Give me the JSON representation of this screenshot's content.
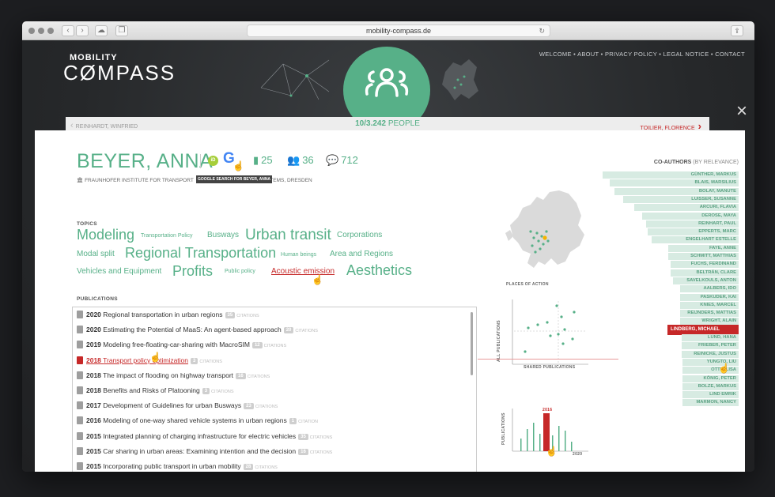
{
  "browser": {
    "url": "mobility-compass.de"
  },
  "site": {
    "logo_top": "MOBILITY",
    "logo_bottom": "CØMPASS",
    "nav": [
      "WELCOME",
      "ABOUT",
      "PRIVACY POLICY",
      "LEGAL NOTICE",
      "CONTACT"
    ]
  },
  "people_bar": {
    "prev_name": "REINHARDT, WINFRIED",
    "current": "10",
    "total": "/3.242",
    "label": " PEOPLE",
    "next_name": "TOILIER, FLORENCE"
  },
  "person": {
    "name": "BEYER, ANNA",
    "orcid_label": "iD",
    "google_tooltip": "GOOGLE SEARCH FOR BEYER, ANNA",
    "institute_pre": "FRAUNHOFER INSTITUTE FOR TRANSPORT",
    "institute_post": "SYSTEMS, DRESDEN",
    "publications_count": "25",
    "coauthors_count": "36",
    "citations_count": "712"
  },
  "topics": {
    "heading": "TOPICS",
    "items": [
      "Modeling",
      "Transportation Policy",
      "Busways",
      "Urban transit",
      "Corporations",
      "Modal split",
      "Regional Transportation",
      "Human beings",
      "Area and Regions",
      "Vehicles and Equipment",
      "Profits",
      "Public policy",
      "Acoustic emission",
      "Aesthetics"
    ]
  },
  "publications": {
    "heading": "PUBLICATIONS",
    "citations_word": "CITATIONS",
    "citation_word_single": "CITATION",
    "items": [
      {
        "year": "2020",
        "title": "Regional transportation in urban regions",
        "cit": "35",
        "word": "CITATIONS"
      },
      {
        "year": "2020",
        "title": "Estimating the Potential of MaaS: An agent-based approach",
        "cit": "20",
        "word": "CITATIONS"
      },
      {
        "year": "2019",
        "title": "Modeling free-floating-car-sharing with MacroSIM",
        "cit": "12",
        "word": "CITATIONS"
      },
      {
        "year": "2018",
        "title": "Transport policy optimization",
        "cit": "3",
        "word": "CITATIONS"
      },
      {
        "year": "2018",
        "title": "The impact of flooding on highway transport",
        "cit": "16",
        "word": "CITATIONS"
      },
      {
        "year": "2018",
        "title": "Benefits and Risks of Platooning",
        "cit": "3",
        "word": "CITATIONS"
      },
      {
        "year": "2017",
        "title": "Development of Guidelines for urban Busways",
        "cit": "23",
        "word": "CITATIONS"
      },
      {
        "year": "2016",
        "title": "Modeling of one-way shared vehicle systems in urban regions",
        "cit": "1",
        "word": "CITATION"
      },
      {
        "year": "2015",
        "title": "Integrated planning of charging infrastructure for electric vehicles",
        "cit": "35",
        "word": "CITATIONS"
      },
      {
        "year": "2015",
        "title": "Car sharing in urban areas: Examining intention and the decision",
        "cit": "16",
        "word": "CITATIONS"
      },
      {
        "year": "2015",
        "title": "Incorporating public transport in urban mobility",
        "cit": "28",
        "word": "CITATIONS"
      }
    ]
  },
  "places": {
    "caption": "PLACES OF ACTION"
  },
  "scatter": {
    "ylabel": "ALL PUBLICATIONS",
    "xlabel": "SHARED PUBLICATIONS"
  },
  "histogram": {
    "ylabel": "PUBLICATIONS",
    "highlight_year": "2016",
    "end_year": "2020"
  },
  "coauthors": {
    "heading": "CO-AUTHORS",
    "heading_sub": "(BY RELEVANCE)",
    "items": [
      "GÜNTHER, MARKUS",
      "BLAIS, MARSILIUS",
      "BOLAY, MANUTE",
      "LUISSER, SUSANNE",
      "ARCURI, FLAVIA",
      "DEROSE, MAYA",
      "REINHART, PAUL",
      "EPPERTS, MARC",
      "ENGELHART ESTELLE",
      "FAYE, ANNE",
      "SCHMITT, MATTHIAS",
      "FUCHS, FERDINAND",
      "BELTRÁN, CLARE",
      "SAVELKOULS, ANTON",
      "AALBERS, IDO",
      "PASKUDER, KAI",
      "KNIES, MARCEL",
      "REIJNDERS, MATTIAS",
      "WRIGHT, ALAIN",
      "LINDBERG, MICHAEL",
      "LUND, HANA",
      "FRIEBER, PETER",
      "REINICKE, JUSTUS",
      "YUNGTO, LIU",
      "OTTE, LISA",
      "KÖNIG, PETER",
      "BOLZE, MARKUS",
      "LIND EMRIK",
      "MARMON, NANCY"
    ],
    "relevance": [
      1.0,
      0.95,
      0.91,
      0.85,
      0.77,
      0.71,
      0.68,
      0.67,
      0.64,
      0.52,
      0.52,
      0.5,
      0.5,
      0.48,
      0.43,
      0.43,
      0.43,
      0.43,
      0.43,
      0.43,
      0.42,
      0.42,
      0.42,
      0.41,
      0.41,
      0.41,
      0.41,
      0.41,
      0.41
    ],
    "selected_index": 19
  },
  "colors": {
    "accent": "#57b088",
    "highlight": "#c62828",
    "bar": "#d7ebe2"
  }
}
